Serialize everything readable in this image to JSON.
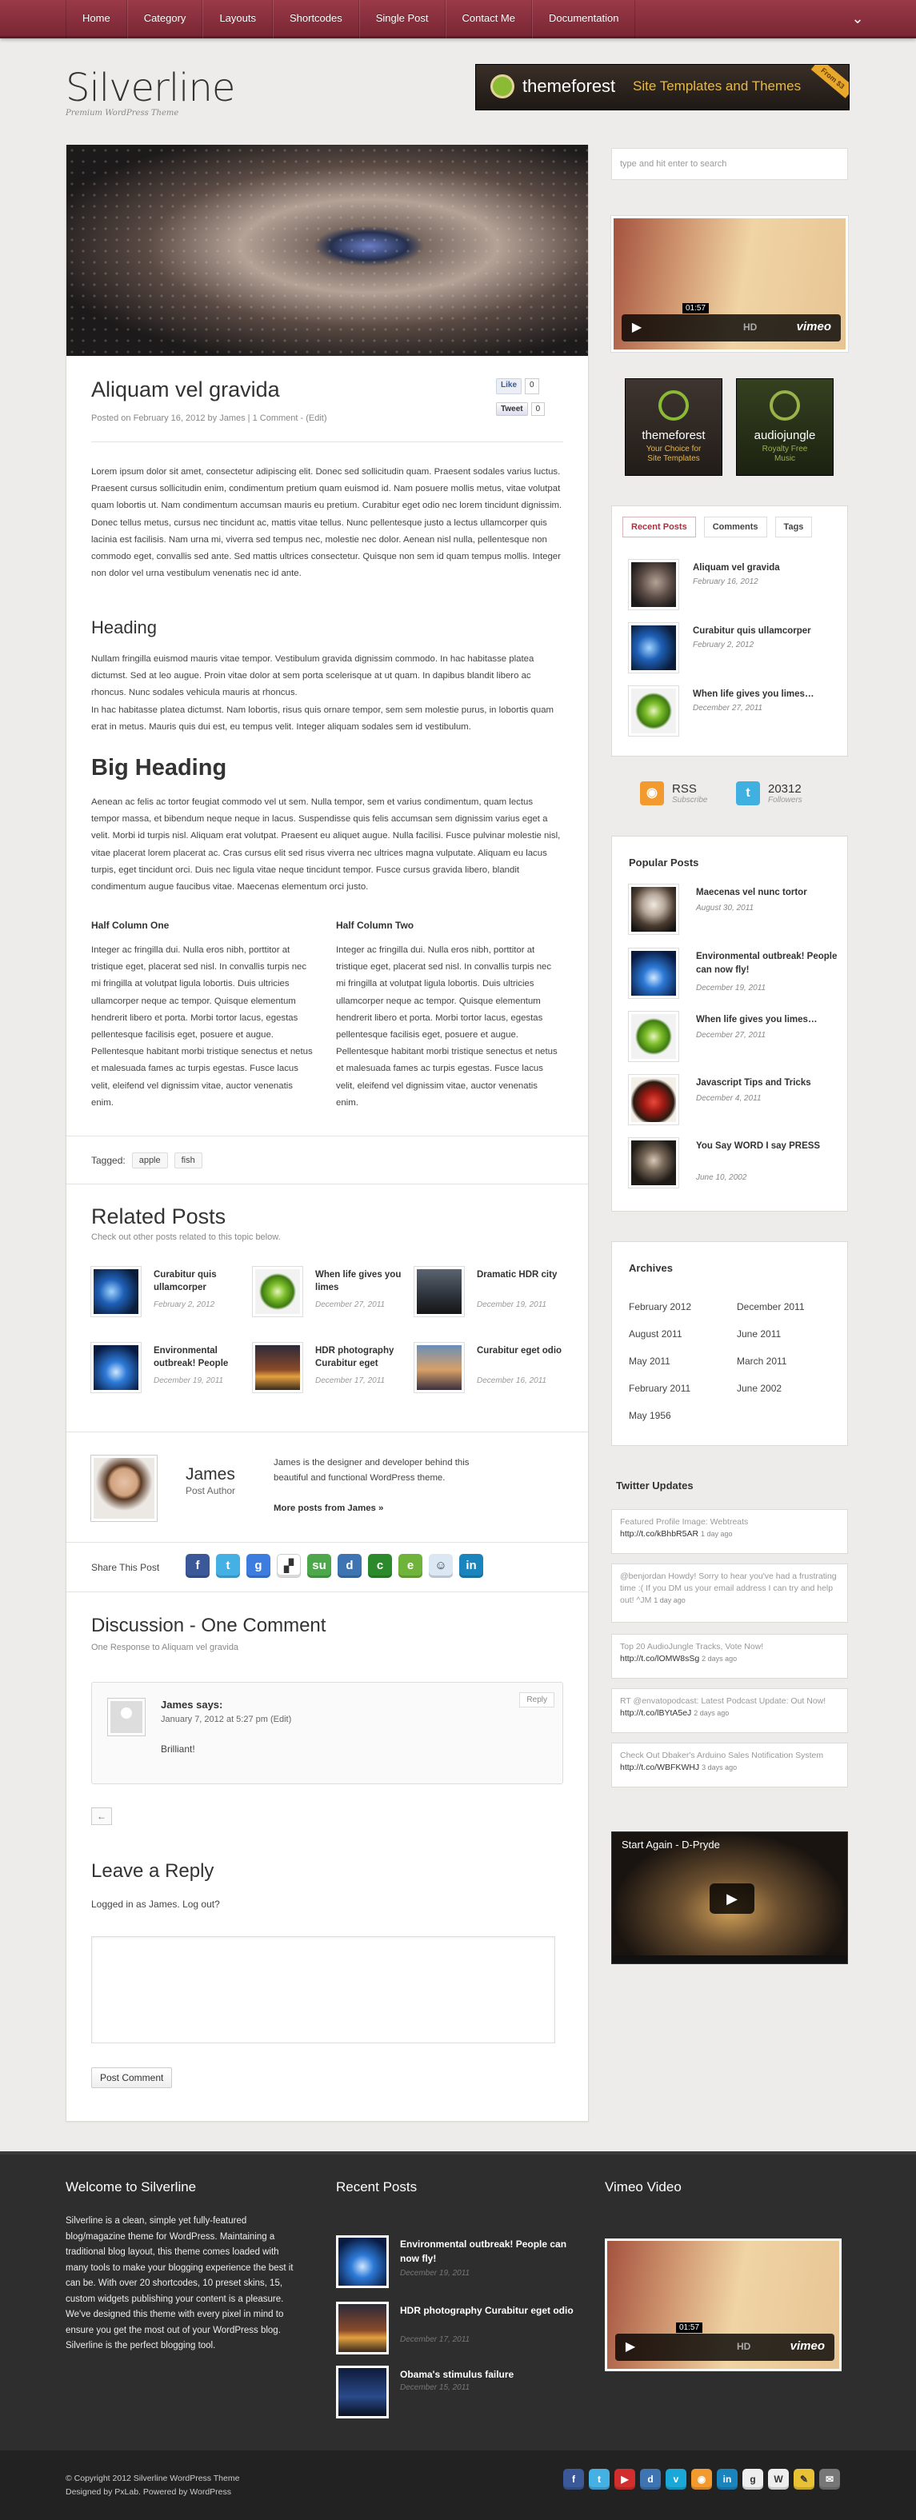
{
  "nav": {
    "items": [
      "Home",
      "Category",
      "Layouts",
      "Shortcodes",
      "Single Post",
      "Contact Me",
      "Documentation"
    ]
  },
  "header": {
    "site_name": "Silverline",
    "tagline": "Premium WordPress Theme",
    "banner": {
      "brand": "themeforest",
      "subtitle": "Site Templates and Themes",
      "ribbon": "From $3"
    }
  },
  "search": {
    "placeholder": "type and hit enter to search"
  },
  "post": {
    "title": "Aliquam vel gravida",
    "meta": "Posted on February 16, 2012 by James | 1 Comment - (Edit)",
    "like_label": "Like",
    "like_count": "0",
    "tweet_label": "Tweet",
    "tweet_count": "0",
    "para1": "Lorem ipsum dolor sit amet, consectetur adipiscing elit. Donec sed sollicitudin quam. Praesent sodales varius luctus. Praesent cursus sollicitudin enim, condimentum pretium quam euismod id. Nam posuere mollis metus, vitae volutpat quam lobortis ut. Nam condimentum accumsan mauris eu pretium. Curabitur eget odio nec lorem tincidunt dignissim. Donec tellus metus, cursus nec tincidunt ac, mattis vitae tellus. Nunc pellentesque justo a lectus ullamcorper quis lacinia est facilisis. Nam urna mi, viverra sed tempus nec, molestie nec dolor. Aenean nisl nulla, pellentesque non commodo eget, convallis sed ante. Sed mattis ultrices consectetur. Quisque non sem id quam tempus mollis. Integer non dolor vel urna vestibulum venenatis nec id ante.",
    "heading": "Heading",
    "para2": "Nullam fringilla euismod mauris vitae tempor. Vestibulum gravida dignissim commodo. In hac habitasse platea dictumst. Sed at leo augue. Proin vitae dolor at sem porta scelerisque at ut quam. In dapibus blandit libero ac rhoncus. Nunc sodales vehicula mauris at rhoncus.",
    "para3": "In hac habitasse platea dictumst. Nam lobortis, risus quis ornare tempor, sem sem molestie purus, in lobortis quam erat in metus. Mauris quis dui est, eu tempus velit. Integer aliquam sodales sem id vestibulum.",
    "big_heading": "Big Heading",
    "para4": "Aenean ac felis ac tortor feugiat commodo vel ut sem. Nulla tempor, sem et varius condimentum, quam lectus tempor massa, et bibendum neque neque in lacus. Suspendisse quis felis accumsan sem dignissim varius eget a velit. Morbi id turpis nisl. Aliquam erat volutpat. Praesent eu aliquet augue. Nulla facilisi. Fusce pulvinar molestie nisl, vitae placerat lorem placerat ac. Cras cursus elit sed risus viverra nec ultrices magna vulputate. Aliquam eu lacus turpis, eget tincidunt orci. Duis nec ligula vitae neque tincidunt tempor. Fusce cursus gravida libero, blandit condimentum augue faucibus vitae. Maecenas elementum orci justo.",
    "col1_title": "Half Column One",
    "col2_title": "Half Column Two",
    "col_text": "Integer ac fringilla dui. Nulla eros nibh, porttitor at tristique eget, placerat sed nisl. In convallis turpis nec mi fringilla at volutpat ligula lobortis. Duis ultricies ullamcorper neque ac tempor. Quisque elementum hendrerit libero et porta. Morbi tortor lacus, egestas pellentesque facilisis eget, posuere et augue. Pellentesque habitant morbi tristique senectus et netus et malesuada fames ac turpis egestas. Fusce lacus velit, eleifend vel dignissim vitae, auctor venenatis enim.",
    "tagged_label": "Tagged:",
    "tags": [
      "apple",
      "fish"
    ]
  },
  "related": {
    "title": "Related Posts",
    "subtitle": "Check out other posts related to this topic below.",
    "items": [
      {
        "title": "Curabitur quis ullamcorper",
        "date": "February 2, 2012"
      },
      {
        "title": "When life gives you limes",
        "date": "December 27, 2011"
      },
      {
        "title": "Dramatic HDR city",
        "date": "December 19, 2011"
      },
      {
        "title": "Environmental outbreak! People",
        "date": "December 19, 2011"
      },
      {
        "title": "HDR photography Curabitur eget",
        "date": "December 17, 2011"
      },
      {
        "title": "Curabitur eget odio",
        "date": "December 16, 2011"
      }
    ]
  },
  "author": {
    "name": "James",
    "role": "Post Author",
    "desc": "James is the designer and developer behind this beautiful and functional WordPress theme.",
    "more": "More posts from James »"
  },
  "share": {
    "label": "Share This Post"
  },
  "discussion": {
    "title": "Discussion - One Comment",
    "subtitle": "One Response to Aliquam vel gravida",
    "comment": {
      "author": "James",
      "says": "says:",
      "date": "January 7, 2012 at 5:27 pm  (Edit)",
      "text": "Brilliant!",
      "reply": "Reply"
    },
    "back": "←"
  },
  "reply": {
    "title": "Leave a Reply",
    "logged": "Logged in as James. Log out?",
    "button": "Post Comment"
  },
  "sidebar": {
    "ad1": {
      "name": "themeforest",
      "sub1": "Your Choice for",
      "sub2": "Site Templates"
    },
    "ad2": {
      "name": "audiojungle",
      "sub1": "Royalty Free",
      "sub2": "Music"
    },
    "video_time": "01:57",
    "video_hd": "HD",
    "video_logo": "vimeo",
    "tabs": [
      "Recent Posts",
      "Comments",
      "Tags"
    ],
    "recent": [
      {
        "title": "Aliquam vel gravida",
        "date": "February 16, 2012"
      },
      {
        "title": "Curabitur quis ullamcorper",
        "date": "February 2, 2012"
      },
      {
        "title": "When life gives you limes…",
        "date": "December 27, 2011"
      }
    ],
    "rss": {
      "label": "RSS",
      "sub": "Subscribe"
    },
    "twitter": {
      "count": "20312",
      "sub": "Followers"
    },
    "popular_title": "Popular Posts",
    "popular": [
      {
        "title": "Maecenas vel nunc tortor",
        "date": "August 30, 2011"
      },
      {
        "title": "Environmental outbreak! People can now fly!",
        "date": "December 19, 2011"
      },
      {
        "title": "When life gives you limes…",
        "date": "December 27, 2011"
      },
      {
        "title": "Javascript Tips and Tricks",
        "date": "December 4, 2011"
      },
      {
        "title": "You Say WORD I say PRESS",
        "date": "June 10, 2002"
      }
    ],
    "archives_title": "Archives",
    "archives": [
      "February 2012",
      "December 2011",
      "August 2011",
      "June 2011",
      "May 2011",
      "March 2011",
      "February 2011",
      "June 2002",
      "May 1956"
    ],
    "twitter_title": "Twitter Updates",
    "tweets": [
      {
        "text": "Featured Profile Image: Webtreats",
        "link": "http://t.co/kBhbR5AR",
        "ago": "1 day ago"
      },
      {
        "text": "@benjordan Howdy! Sorry to hear you've had a frustrating time :( If you DM us your email address I can try and help out! ^JM",
        "link": "",
        "ago": "1 day ago"
      },
      {
        "text": "Top 20 AudioJungle Tracks, Vote Now!",
        "link": "http://t.co/lOMW8sSg",
        "ago": "2 days ago"
      },
      {
        "text": "RT @envatopodcast: Latest Podcast Update: Out Now!",
        "link": "http://t.co/lBYtA5eJ",
        "ago": "2 days ago"
      },
      {
        "text": "Check Out Dbaker's Arduino Sales Notification System",
        "link": "http://t.co/WBFKWHJ",
        "ago": "3 days ago"
      }
    ],
    "video2_title": "Start Again - D-Pryde"
  },
  "footer": {
    "welcome_title": "Welcome to Silverline",
    "welcome_text": "Silverline is a clean, simple yet fully-featured blog/magazine theme for WordPress. Maintaining a traditional blog layout, this theme comes loaded with many tools to make your blogging experience the best it can be. With over 20 shortcodes, 10 preset skins, 15, custom widgets publishing your content is a pleasure. We've designed this theme with every pixel in mind to ensure you get the most out of your WordPress blog. Silverline is the perfect blogging tool.",
    "recent_title": "Recent Posts",
    "recent": [
      {
        "title": "Environmental outbreak! People can now fly!",
        "date": "December 19, 2011"
      },
      {
        "title": "HDR photography Curabitur eget odio",
        "date": "December 17, 2011"
      },
      {
        "title": "Obama's stimulus failure",
        "date": "December 15, 2011"
      }
    ],
    "vimeo_title": "Vimeo Video",
    "copyright": "© Copyright 2012 Silverline WordPress Theme",
    "credits": "Designed by PxLab. Powered by WordPress"
  }
}
